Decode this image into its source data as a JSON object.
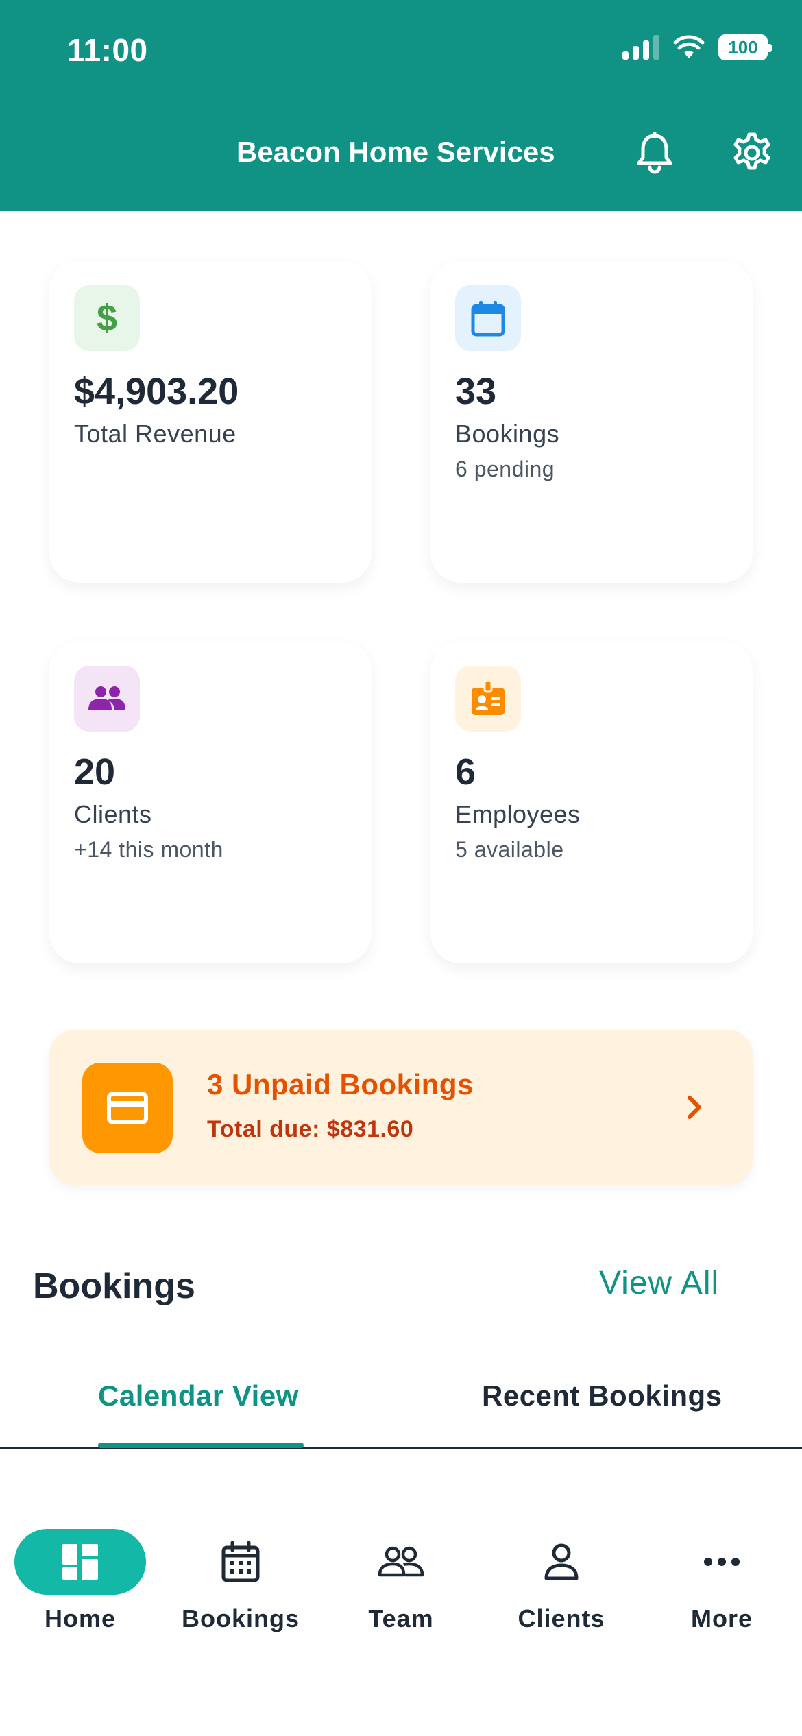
{
  "status_bar": {
    "time": "11:00",
    "battery": "100"
  },
  "header": {
    "title": "Beacon Home Services",
    "icons": [
      "bell-icon",
      "gear-icon"
    ]
  },
  "stats": [
    {
      "icon": "dollar-icon",
      "value": "$4,903.20",
      "label": "Total Revenue",
      "sub": ""
    },
    {
      "icon": "calendar-icon",
      "value": "33",
      "label": "Bookings",
      "sub": "6 pending"
    },
    {
      "icon": "people-icon",
      "value": "20",
      "label": "Clients",
      "sub": "+14 this month"
    },
    {
      "icon": "badge-icon",
      "value": "6",
      "label": "Employees",
      "sub": "5 available"
    }
  ],
  "unpaid": {
    "icon": "credit-card-icon",
    "title": "3 Unpaid Bookings",
    "subtitle": "Total due: $831.60"
  },
  "bookings_section": {
    "title": "Bookings",
    "view_all": "View All"
  },
  "tabs": [
    {
      "label": "Calendar View",
      "active": true
    },
    {
      "label": "Recent Bookings",
      "active": false
    }
  ],
  "bottom_nav": [
    {
      "label": "Home",
      "icon": "dashboard-icon",
      "active": true
    },
    {
      "label": "Bookings",
      "icon": "calendar-icon",
      "active": false
    },
    {
      "label": "Team",
      "icon": "team-icon",
      "active": false
    },
    {
      "label": "Clients",
      "icon": "person-icon",
      "active": false
    },
    {
      "label": "More",
      "icon": "more-icon",
      "active": false
    }
  ],
  "colors": {
    "primary": "#109385",
    "nav_active": "#14b8a6",
    "revenue": "#43a047",
    "bookings": "#1e88e5",
    "clients": "#8e24aa",
    "employees": "#fb8c00",
    "unpaid_accent": "#e65100"
  }
}
